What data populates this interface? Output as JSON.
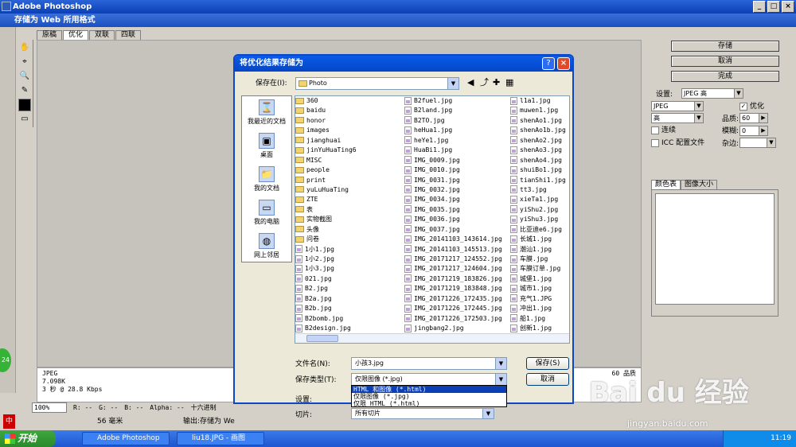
{
  "app": {
    "title": "Adobe Photoshop",
    "subtitle": "存储为 Web 所用格式"
  },
  "tabs": [
    "原稿",
    "优化",
    "双联",
    "四联"
  ],
  "canvas_info": {
    "line1": "JPEG",
    "line2": "7.098K",
    "line3": "3 秒 @ 28.8 Kbps",
    "quality": "60 品质"
  },
  "statusbar": {
    "zoom": "100%",
    "r": "R: --",
    "g": "G: --",
    "b": "B: --",
    "alpha": "Alpha: --",
    "hex": "十六进制"
  },
  "bottom": {
    "ime": "中",
    "size": "56 毫米",
    "output": "输出:存储为 We"
  },
  "right": {
    "save": "存储",
    "cancel": "取消",
    "done": "完成",
    "settings_label": "设置:",
    "settings_value": "JPEG 高",
    "format": "JPEG",
    "quality_level": "高",
    "optimized": "优化",
    "quality_label": "品质:",
    "quality_value": "60",
    "progressive": "连续",
    "blur_label": "模糊:",
    "blur_value": "0",
    "icc": "ICC 配置文件",
    "matte_label": "杂边:",
    "tab_color": "颜色表",
    "tab_size": "图像大小"
  },
  "dialog": {
    "title": "将优化结果存储为",
    "save_in_label": "保存在(I):",
    "folder": "Photo",
    "places": [
      "我最近的文档",
      "桌面",
      "我的文档",
      "我的电脑",
      "网上邻居"
    ],
    "col1": [
      {
        "n": "360",
        "f": true
      },
      {
        "n": "baidu",
        "f": true
      },
      {
        "n": "honor",
        "f": true
      },
      {
        "n": "images",
        "f": true
      },
      {
        "n": "jianghuai",
        "f": true
      },
      {
        "n": "jinYuHuaTing6",
        "f": true
      },
      {
        "n": "MISC",
        "f": true
      },
      {
        "n": "people",
        "f": true
      },
      {
        "n": "print",
        "f": true
      },
      {
        "n": "yuLuHuaTing",
        "f": true
      },
      {
        "n": "ZTE",
        "f": true
      },
      {
        "n": "表",
        "f": true
      },
      {
        "n": "实物截图",
        "f": true
      },
      {
        "n": "头像",
        "f": true
      },
      {
        "n": "问卷",
        "f": true
      },
      {
        "n": "1小1.jpg",
        "f": false
      },
      {
        "n": "1小2.jpg",
        "f": false
      },
      {
        "n": "1小3.jpg",
        "f": false
      },
      {
        "n": "021.jpg",
        "f": false
      },
      {
        "n": "B2.jpg",
        "f": false
      },
      {
        "n": "B2a.jpg",
        "f": false
      },
      {
        "n": "B2b.jpg",
        "f": false
      },
      {
        "n": "B2bomb.jpg",
        "f": false
      },
      {
        "n": "B2design.jpg",
        "f": false
      }
    ],
    "col2": [
      "B2fuel.jpg",
      "B2land.jpg",
      "B2TO.jpg",
      "heHua1.jpg",
      "heYe1.jpg",
      "HuaBi1.jpg",
      "IMG_0009.jpg",
      "IMG_0010.jpg",
      "IMG_0031.jpg",
      "IMG_0032.jpg",
      "IMG_0034.jpg",
      "IMG_0035.jpg",
      "IMG_0036.jpg",
      "IMG_0037.jpg",
      "IMG_20141103_143614.jpg",
      "IMG_20141103_145513.jpg",
      "IMG_20171217_124552.jpg",
      "IMG_20171217_124604.jpg",
      "IMG_20171219_183826.jpg",
      "IMG_20171219_183848.jpg",
      "IMG_20171226_172435.jpg",
      "IMG_20171226_172445.jpg",
      "IMG_20171226_172503.jpg",
      "jingbang2.jpg"
    ],
    "col3": [
      "l1a1.jpg",
      "muwen1.jpg",
      "shenAo1.jpg",
      "shenAo1b.jpg",
      "shenAo2.jpg",
      "shenAo3.jpg",
      "shenAo4.jpg",
      "shuiBo1.jpg",
      "tianShi1.jpg",
      "tt3.jpg",
      "xieTa1.jpg",
      "yiShu2.jpg",
      "yiShu3.jpg",
      "比亚迪e6.jpg",
      "长城1.jpg",
      "潮汕1.jpg",
      "车膜.jpg",
      "车膜订单.jpg",
      "城堡1.jpg",
      "城市1.jpg",
      "充气1.JPG",
      "冲出1.jpg",
      "船1.jpg",
      "创新1.jpg"
    ],
    "filename_label": "文件名(N):",
    "filename_value": "小孩3.jpg",
    "type_label": "保存类型(T):",
    "type_value": "仅限图像 (*.jpg)",
    "settings_label": "设置:",
    "slices_label": "切片:",
    "slices_value": "所有切片",
    "save_btn": "保存(S)",
    "cancel_btn": "取消",
    "type_options": [
      "HTML 和图像 (*.html)",
      "仅限图像 (*.jpg)",
      "仅限 HTML (*.html)"
    ]
  },
  "taskbar": {
    "start": "开始",
    "tasks": [
      "Adobe Photoshop",
      "liu18.JPG - 画图"
    ],
    "time": "11:19"
  },
  "watermark": {
    "brand": "Bai du 经验",
    "url": "jingyan.baidu.com"
  },
  "badge": "24"
}
